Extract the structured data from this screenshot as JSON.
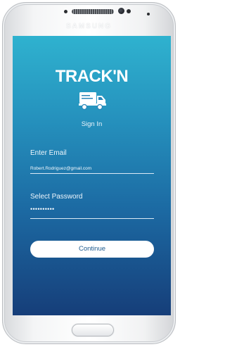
{
  "device": {
    "brand": "SAMSUNG"
  },
  "app": {
    "logo_text": "TRACK'N",
    "logo_icon": "truck-icon",
    "title": "Sign In"
  },
  "form": {
    "email_label": "Enter Email",
    "email_value": "Robert.Rodriguez@gmail.com",
    "password_label": "Select Password",
    "password_value": "••••••••••"
  },
  "actions": {
    "continue_label": "Continue"
  },
  "colors": {
    "screen_top": "#2fb2cf",
    "screen_bottom": "#163e79",
    "button_text": "#1e5b8f"
  }
}
